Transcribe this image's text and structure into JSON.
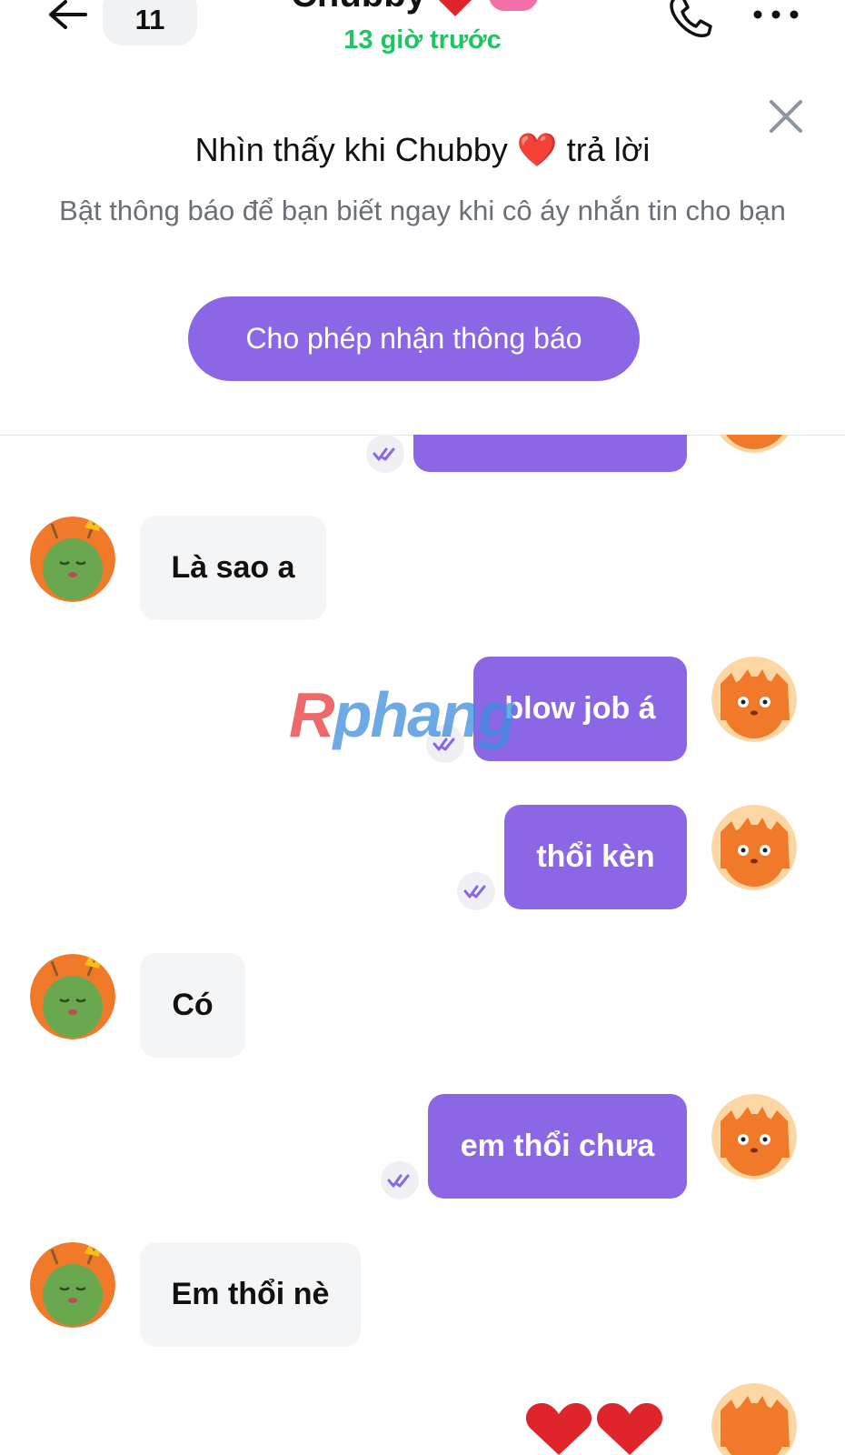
{
  "header": {
    "unread_count": "11",
    "contact_name": "Chubby",
    "last_seen": "13 giờ trước"
  },
  "banner": {
    "title": "Nhìn thấy khi Chubby ❤️ trả lời",
    "subtitle": "Bật thông báo để bạn biết ngay khi cô áy nhắn tin cho bạn",
    "button": "Cho phép nhận thông báo"
  },
  "messages": [
    {
      "side": "in",
      "text": "Là sao a"
    },
    {
      "side": "out",
      "text": "blow job á"
    },
    {
      "side": "out",
      "text": "thổi kèn"
    },
    {
      "side": "in",
      "text": "Có"
    },
    {
      "side": "out",
      "text": "em thổi chưa"
    },
    {
      "side": "in",
      "text": "Em thổi nè"
    }
  ],
  "watermark": "Rphang",
  "colors": {
    "accent": "#8b67e6",
    "online_status": "#20c463",
    "incoming_bubble": "#f4f5f7"
  }
}
